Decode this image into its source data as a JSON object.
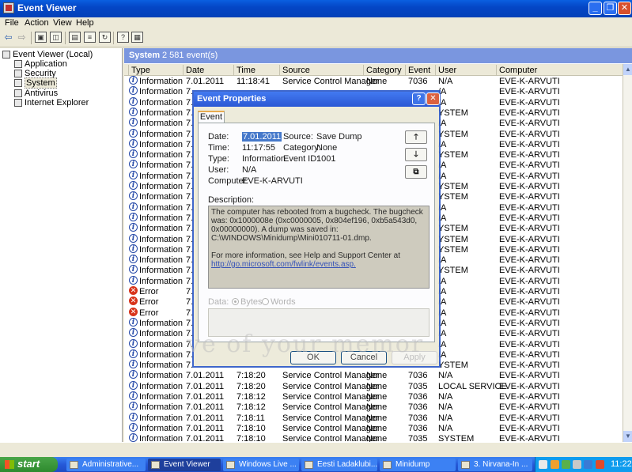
{
  "window": {
    "title": "Event Viewer"
  },
  "menu": [
    "File",
    "Action",
    "View",
    "Help"
  ],
  "tree": {
    "root": "Event Viewer (Local)",
    "items": [
      "Application",
      "Security",
      "System",
      "Antivirus",
      "Internet Explorer"
    ],
    "selected": "System"
  },
  "panel": {
    "title": "System",
    "count": "2 581 event(s)"
  },
  "columns": [
    "Type",
    "Date",
    "Time",
    "Source",
    "Category",
    "Event",
    "User",
    "Computer"
  ],
  "rows": [
    [
      "Information",
      "7.01.2011",
      "11:18:41",
      "Service Control Manager",
      "None",
      "7036",
      "N/A",
      "EVE-K-ARVUTI"
    ],
    [
      "Information",
      "7.",
      "",
      "",
      "",
      "",
      "/A",
      "EVE-K-ARVUTI"
    ],
    [
      "Information",
      "7.",
      "",
      "",
      "",
      "",
      "/A",
      "EVE-K-ARVUTI"
    ],
    [
      "Information",
      "7.",
      "",
      "",
      "",
      "",
      "YSTEM",
      "EVE-K-ARVUTI"
    ],
    [
      "Information",
      "7.",
      "",
      "",
      "",
      "",
      "/A",
      "EVE-K-ARVUTI"
    ],
    [
      "Information",
      "7.",
      "",
      "",
      "",
      "",
      "YSTEM",
      "EVE-K-ARVUTI"
    ],
    [
      "Information",
      "7.",
      "",
      "",
      "",
      "",
      "/A",
      "EVE-K-ARVUTI"
    ],
    [
      "Information",
      "7.",
      "",
      "",
      "",
      "",
      "YSTEM",
      "EVE-K-ARVUTI"
    ],
    [
      "Information",
      "7.",
      "",
      "",
      "",
      "",
      "/A",
      "EVE-K-ARVUTI"
    ],
    [
      "Information",
      "7.",
      "",
      "",
      "",
      "",
      "/A",
      "EVE-K-ARVUTI"
    ],
    [
      "Information",
      "7.",
      "",
      "",
      "",
      "",
      "YSTEM",
      "EVE-K-ARVUTI"
    ],
    [
      "Information",
      "7.",
      "",
      "",
      "",
      "",
      "YSTEM",
      "EVE-K-ARVUTI"
    ],
    [
      "Information",
      "7.",
      "",
      "",
      "",
      "",
      "/A",
      "EVE-K-ARVUTI"
    ],
    [
      "Information",
      "7.",
      "",
      "",
      "",
      "",
      "/A",
      "EVE-K-ARVUTI"
    ],
    [
      "Information",
      "7.",
      "",
      "",
      "",
      "",
      "YSTEM",
      "EVE-K-ARVUTI"
    ],
    [
      "Information",
      "7.",
      "",
      "",
      "",
      "",
      "YSTEM",
      "EVE-K-ARVUTI"
    ],
    [
      "Information",
      "7.",
      "",
      "",
      "",
      "",
      "YSTEM",
      "EVE-K-ARVUTI"
    ],
    [
      "Information",
      "7.",
      "",
      "",
      "",
      "",
      "/A",
      "EVE-K-ARVUTI"
    ],
    [
      "Information",
      "7.",
      "",
      "",
      "",
      "",
      "YSTEM",
      "EVE-K-ARVUTI"
    ],
    [
      "Information",
      "7.",
      "",
      "",
      "",
      "",
      "/A",
      "EVE-K-ARVUTI"
    ],
    [
      "Error",
      "7.",
      "",
      "",
      "",
      "",
      "/A",
      "EVE-K-ARVUTI"
    ],
    [
      "Error",
      "7.",
      "",
      "",
      "",
      "",
      "/A",
      "EVE-K-ARVUTI"
    ],
    [
      "Error",
      "7.",
      "",
      "",
      "",
      "",
      "/A",
      "EVE-K-ARVUTI"
    ],
    [
      "Information",
      "7.",
      "",
      "",
      "",
      "",
      "/A",
      "EVE-K-ARVUTI"
    ],
    [
      "Information",
      "7.",
      "",
      "",
      "",
      "",
      "/A",
      "EVE-K-ARVUTI"
    ],
    [
      "Information",
      "7.",
      "",
      "",
      "",
      "",
      "/A",
      "EVE-K-ARVUTI"
    ],
    [
      "Information",
      "7.",
      "",
      "",
      "",
      "",
      "/A",
      "EVE-K-ARVUTI"
    ],
    [
      "Information",
      "7.",
      "",
      "",
      "",
      "",
      "YSTEM",
      "EVE-K-ARVUTI"
    ],
    [
      "Information",
      "7.01.2011",
      "7:18:20",
      "Service Control Manager",
      "None",
      "7036",
      "N/A",
      "EVE-K-ARVUTI"
    ],
    [
      "Information",
      "7.01.2011",
      "7:18:20",
      "Service Control Manager",
      "None",
      "7035",
      "LOCAL SERVICE",
      "EVE-K-ARVUTI"
    ],
    [
      "Information",
      "7.01.2011",
      "7:18:12",
      "Service Control Manager",
      "None",
      "7036",
      "N/A",
      "EVE-K-ARVUTI"
    ],
    [
      "Information",
      "7.01.2011",
      "7:18:12",
      "Service Control Manager",
      "None",
      "7036",
      "N/A",
      "EVE-K-ARVUTI"
    ],
    [
      "Information",
      "7.01.2011",
      "7:18:11",
      "Service Control Manager",
      "None",
      "7036",
      "N/A",
      "EVE-K-ARVUTI"
    ],
    [
      "Information",
      "7.01.2011",
      "7:18:10",
      "Service Control Manager",
      "None",
      "7036",
      "N/A",
      "EVE-K-ARVUTI"
    ],
    [
      "Information",
      "7.01.2011",
      "7:18:10",
      "Service Control Manager",
      "None",
      "7035",
      "SYSTEM",
      "EVE-K-ARVUTI"
    ]
  ],
  "dialog": {
    "title": "Event Properties",
    "tab": "Event",
    "date_label": "Date:",
    "date": "7.01.2011",
    "source_label": "Source:",
    "source": "Save Dump",
    "time_label": "Time:",
    "time": "11:17:55",
    "category_label": "Category:",
    "category": "None",
    "type_label": "Type:",
    "type": "Information",
    "eventid_label": "Event ID:",
    "eventid": "1001",
    "user_label": "User:",
    "user": "N/A",
    "computer_label": "Computer:",
    "computer": "EVE-K-ARVUTI",
    "description_label": "Description:",
    "description": "The computer has rebooted from a bugcheck.  The bugcheck was: 0x1000008e (0xc0000005, 0x804ef196, 0xb5a543d0, 0x00000000). A dump was saved in: C:\\WINDOWS\\Minidump\\Mini010711-01.dmp.",
    "help_text": "For more information, see Help and Support Center at",
    "help_link": "http://go.microsoft.com/fwlink/events.asp.",
    "data_label": "Data:",
    "bytes_label": "Bytes",
    "words_label": "Words",
    "ok": "OK",
    "cancel": "Cancel",
    "apply": "Apply"
  },
  "watermark": "ve of your memor",
  "taskbar": {
    "start": "start",
    "tasks": [
      "Administrative...",
      "Event Viewer",
      "Windows Live ...",
      "Eesti Ladaklubi...",
      "Minidump",
      "3. Nirvana-In ..."
    ],
    "active": "Event Viewer",
    "clock": "11:22"
  }
}
